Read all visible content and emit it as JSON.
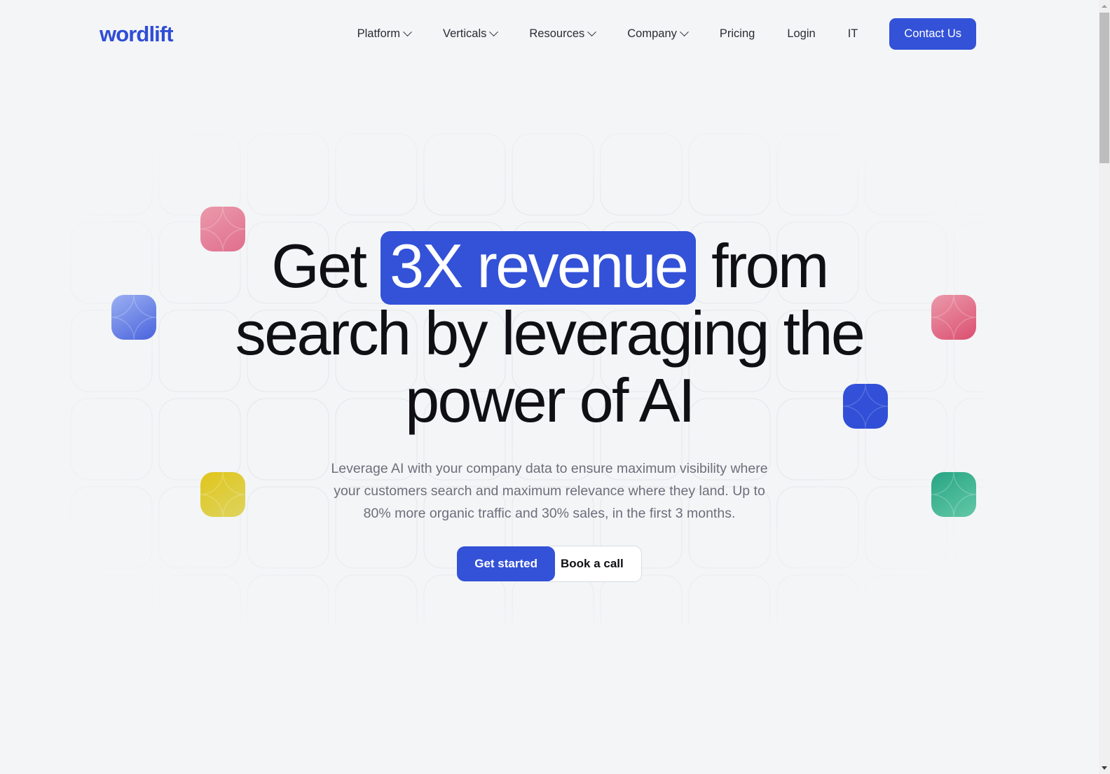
{
  "brand": {
    "name": "wordlift",
    "color": "#2f4ed6"
  },
  "nav": {
    "items": [
      {
        "label": "Platform",
        "has_dropdown": true,
        "icon": "chevron-down-icon"
      },
      {
        "label": "Verticals",
        "has_dropdown": true,
        "icon": "chevron-down-icon"
      },
      {
        "label": "Resources",
        "has_dropdown": true,
        "icon": "chevron-down-icon"
      },
      {
        "label": "Company",
        "has_dropdown": true,
        "icon": "chevron-down-icon"
      },
      {
        "label": "Pricing",
        "has_dropdown": false,
        "icon": ""
      },
      {
        "label": "Login",
        "has_dropdown": false,
        "icon": ""
      },
      {
        "label": "IT",
        "has_dropdown": false,
        "icon": ""
      }
    ],
    "cta_label": "Contact Us",
    "cta_color": "#3352d8"
  },
  "hero": {
    "heading_part1": "Get ",
    "heading_highlight": "3X revenue",
    "heading_part2": " from search by leveraging the power of AI",
    "highlight_color": "#3352d8",
    "subtitle": "Leverage AI with your company data to ensure maximum visibility where your customers search and maximum relevance where they land. Up to 80% more organic traffic and 30% sales, in the first 3 months.",
    "primary_cta": "Get started",
    "secondary_cta": "Book a call"
  },
  "decorations": {
    "squares": [
      {
        "name": "pink-square-top-left",
        "color": "#e06e8d"
      },
      {
        "name": "blue-square-left",
        "color": "#4a63dd"
      },
      {
        "name": "yellow-square-left",
        "color": "#ddd45f"
      },
      {
        "name": "pink-square-right",
        "color": "#db4f70"
      },
      {
        "name": "blue-square-right",
        "color": "#2f4ed6"
      },
      {
        "name": "teal-square-right",
        "color": "#27a584"
      }
    ]
  },
  "scrollbar": {
    "up_icon": "triangle-up-icon",
    "down_icon": "triangle-down-icon",
    "position_percent": 0
  }
}
